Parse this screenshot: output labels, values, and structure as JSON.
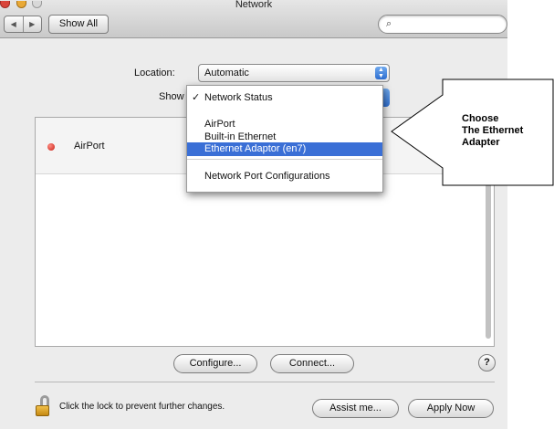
{
  "window": {
    "title": "Network"
  },
  "toolbar": {
    "back_glyph": "◀",
    "forward_glyph": "▶",
    "show_all_label": "Show All",
    "search_placeholder": "",
    "search_icon": "search-icon"
  },
  "location": {
    "label": "Location:",
    "value": "Automatic"
  },
  "show": {
    "label": "Show",
    "menu_items": [
      {
        "label": "Network Status",
        "checked": true
      },
      {
        "label": "AirPort"
      },
      {
        "label": "Built-in Ethernet"
      },
      {
        "label": "Ethernet Adaptor (en7)",
        "highlighted": true
      },
      {
        "label": "Network Port Configurations"
      }
    ]
  },
  "list": {
    "rows": [
      {
        "label": "AirPort",
        "status_color": "#d22a1f"
      }
    ]
  },
  "buttons": {
    "configure": "Configure...",
    "connect": "Connect...",
    "help": "?",
    "assist": "Assist me...",
    "apply": "Apply Now"
  },
  "lock": {
    "text": "Click the lock to prevent further changes."
  },
  "annotation": {
    "lines": [
      "Choose",
      "The Ethernet",
      "Adapter"
    ]
  },
  "colors": {
    "menu_highlight": "#3a6fd6",
    "accent_blue": "#2f6fd0"
  }
}
